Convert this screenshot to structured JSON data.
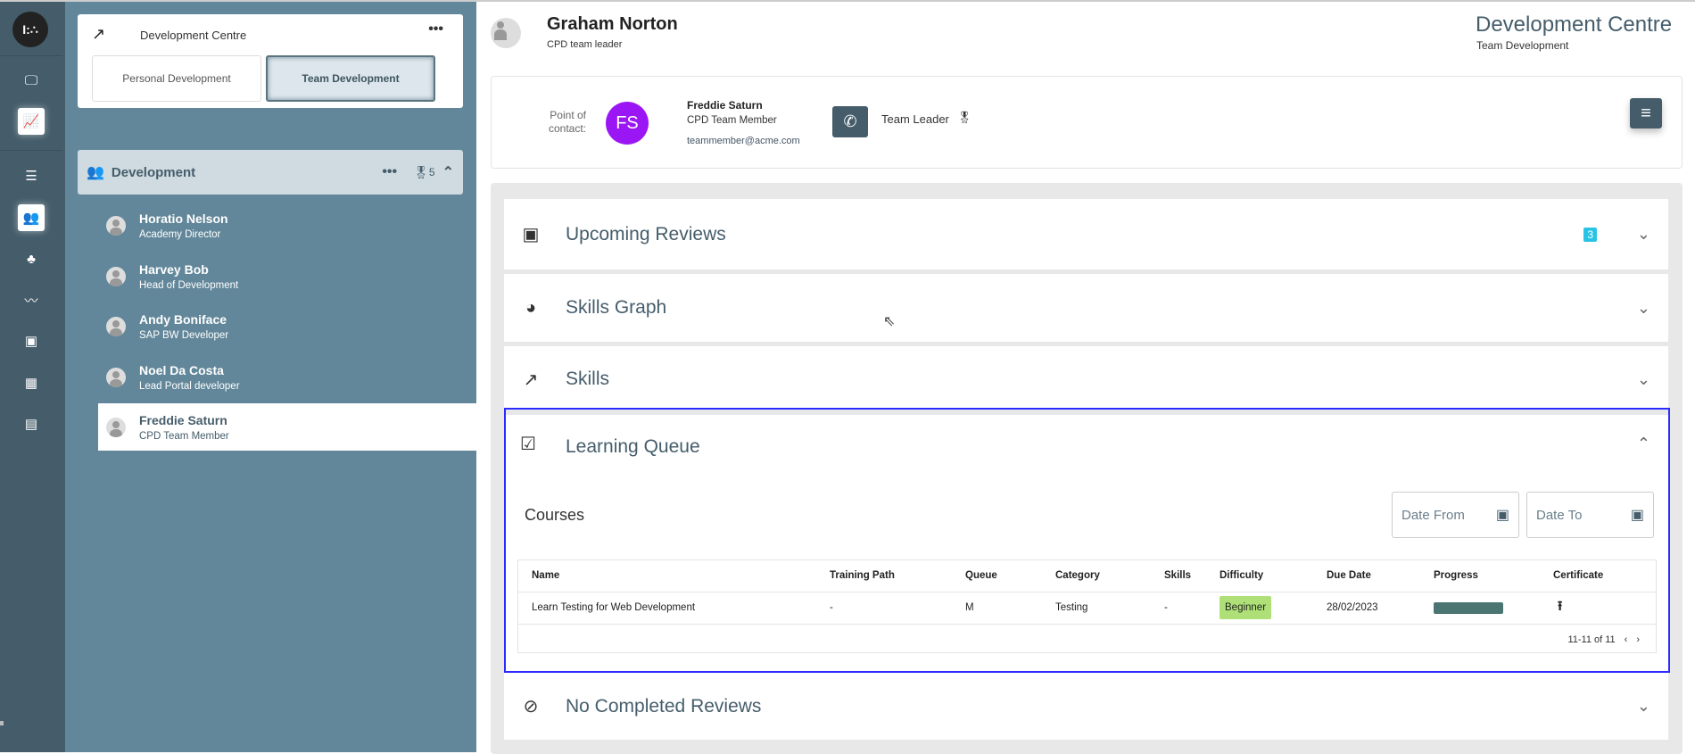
{
  "rail": {
    "logo": "I:∴",
    "icons": [
      "presentation-icon",
      "chart-icon",
      "list-icon",
      "team-icon",
      "org-icon",
      "trend-icon",
      "event-icon",
      "calendar-icon",
      "document-icon"
    ]
  },
  "sidebar": {
    "card_title": "Development Centre",
    "tabs": [
      "Personal Development",
      "Team Development"
    ],
    "group": {
      "name": "Development",
      "badge_count": "5"
    },
    "members": [
      {
        "name": "Horatio Nelson",
        "role": "Academy Director"
      },
      {
        "name": "Harvey Bob",
        "role": "Head of Development"
      },
      {
        "name": "Andy Boniface",
        "role": "SAP BW Developer"
      },
      {
        "name": "Noel Da Costa",
        "role": "Lead Portal developer"
      },
      {
        "name": "Freddie Saturn",
        "role": "CPD Team Member"
      }
    ]
  },
  "header": {
    "user_name": "Graham Norton",
    "user_role": "CPD team leader",
    "app_title": "Development Centre",
    "app_subtitle": "Team Development"
  },
  "contact": {
    "label": "Point of contact:",
    "initials": "FS",
    "name": "Freddie Saturn",
    "role": "CPD Team Member",
    "email": "teammember@acme.com",
    "relation": "Team Leader",
    "avatar_color": "#9b16f5"
  },
  "panels": {
    "upcoming": {
      "title": "Upcoming Reviews",
      "badge": "3"
    },
    "skills_graph": {
      "title": "Skills Graph"
    },
    "skills": {
      "title": "Skills"
    },
    "learning": {
      "title": "Learning Queue"
    },
    "completed": {
      "title": "No Completed Reviews"
    }
  },
  "courses": {
    "title": "Courses",
    "date_from": "Date From",
    "date_to": "Date To",
    "columns": [
      "Name",
      "Training Path",
      "Queue",
      "Category",
      "Skills",
      "Difficulty",
      "Due Date",
      "Progress",
      "Certificate"
    ],
    "rows": [
      {
        "name": "Learn Testing for Web Development",
        "path": "-",
        "queue": "M",
        "category": "Testing",
        "skills": "-",
        "difficulty": "Beginner",
        "due": "28/02/2023",
        "progress": 100
      }
    ],
    "pagination": "11-11 of 11"
  }
}
